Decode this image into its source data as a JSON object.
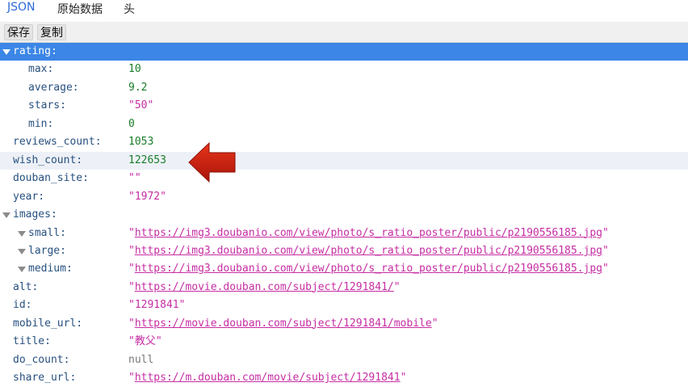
{
  "tabs": [
    {
      "label": "JSON",
      "active": true
    },
    {
      "label": "原始数据",
      "active": false
    },
    {
      "label": "头",
      "active": false
    }
  ],
  "toolbar": {
    "save_label": "保存",
    "copy_label": "复制"
  },
  "tree": [
    {
      "key": "rating:",
      "value": "",
      "type": "object",
      "depth": 0,
      "expanded": true,
      "selected": true
    },
    {
      "key": "max:",
      "value": "10",
      "type": "number",
      "depth": 1
    },
    {
      "key": "average:",
      "value": "9.2",
      "type": "number",
      "depth": 1
    },
    {
      "key": "stars:",
      "value": "\"50\"",
      "type": "string",
      "depth": 1
    },
    {
      "key": "min:",
      "value": "0",
      "type": "number",
      "depth": 1
    },
    {
      "key": "reviews_count:",
      "value": "1053",
      "type": "number",
      "depth": 0
    },
    {
      "key": "wish_count:",
      "value": "122653",
      "type": "number",
      "depth": 0,
      "hover": true
    },
    {
      "key": "douban_site:",
      "value": "\"\"",
      "type": "string",
      "depth": 0
    },
    {
      "key": "year:",
      "value": "\"1972\"",
      "type": "string",
      "depth": 0
    },
    {
      "key": "images:",
      "value": "",
      "type": "object",
      "depth": 0,
      "expanded": true
    },
    {
      "key": "small:",
      "value": "https://img3.doubanio.com/view/photo/s_ratio_poster/public/p2190556185.jpg",
      "type": "link",
      "depth": 1,
      "expanded": true
    },
    {
      "key": "large:",
      "value": "https://img3.doubanio.com/view/photo/s_ratio_poster/public/p2190556185.jpg",
      "type": "link",
      "depth": 1,
      "expanded": true
    },
    {
      "key": "medium:",
      "value": "https://img3.doubanio.com/view/photo/s_ratio_poster/public/p2190556185.jpg",
      "type": "link",
      "depth": 1,
      "expanded": true
    },
    {
      "key": "alt:",
      "value": "https://movie.douban.com/subject/1291841/",
      "type": "link",
      "depth": 0
    },
    {
      "key": "id:",
      "value": "\"1291841\"",
      "type": "string",
      "depth": 0
    },
    {
      "key": "mobile_url:",
      "value": "https://movie.douban.com/subject/1291841/mobile",
      "type": "link",
      "depth": 0
    },
    {
      "key": "title:",
      "value": "\"教父\"",
      "type": "string",
      "depth": 0
    },
    {
      "key": "do_count:",
      "value": "null",
      "type": "null",
      "depth": 0
    },
    {
      "key": "share_url:",
      "value": "https://m.douban.com/movie/subject/1291841",
      "type": "link",
      "depth": 0
    }
  ],
  "colors": {
    "selected_row": "#3b86e6",
    "key": "#27507f",
    "number": "#1a7d2a",
    "string": "#c62da3",
    "active_tab": "#2f6bd8",
    "arrow": "#d4230f"
  },
  "annotation": {
    "icon": "red-arrow-icon"
  }
}
